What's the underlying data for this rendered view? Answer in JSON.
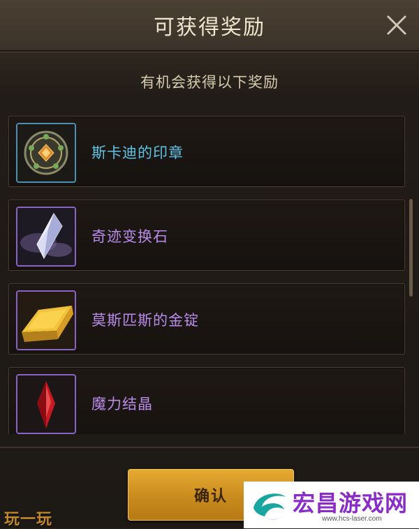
{
  "dialog": {
    "title": "可获得奖励",
    "subtitle": "有机会获得以下奖励",
    "confirm_label": "确认"
  },
  "rewards": [
    {
      "name": "斯卡迪的印章",
      "icon": "seal-icon",
      "name_color": "#5fc3e6"
    },
    {
      "name": "奇迹变换石",
      "icon": "crystal-icon",
      "name_color": "#b98be8"
    },
    {
      "name": "莫斯匹斯的金锭",
      "icon": "gold-ingot-icon",
      "name_color": "#b98be8"
    },
    {
      "name": "魔力结晶",
      "icon": "red-crystal-icon",
      "name_color": "#b98be8"
    }
  ],
  "watermarks": {
    "left_text": "玩一玩",
    "brand": "宏昌游戏网",
    "url": "www.hcs-laser.com"
  },
  "colors": {
    "accent_button": "#d99a26",
    "blue_frame": "#4e8fb5",
    "purple_frame": "#8b63c4"
  }
}
